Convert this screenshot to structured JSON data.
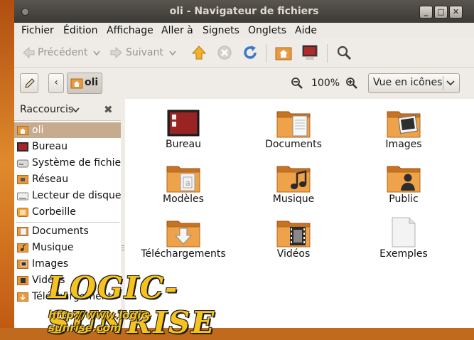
{
  "window": {
    "title": "oli - Navigateur de fichiers",
    "btn_min": "_",
    "btn_max": "□",
    "btn_close": "✕"
  },
  "menubar": {
    "items": [
      {
        "label": "Fichier"
      },
      {
        "label": "Édition"
      },
      {
        "label": "Affichage"
      },
      {
        "label": "Aller à"
      },
      {
        "label": "Signets"
      },
      {
        "label": "Onglets"
      },
      {
        "label": "Aide"
      }
    ]
  },
  "toolbar": {
    "back_label": "Précédent",
    "forward_label": "Suivant"
  },
  "location": {
    "path_back": "‹",
    "path_current": "oli",
    "zoom": "100%",
    "view_mode": "Vue en icônes"
  },
  "sidebar": {
    "header": "Raccourcis",
    "close": "✖",
    "items": [
      {
        "label": "oli",
        "icon": "home-folder-icon"
      },
      {
        "label": "Bureau",
        "icon": "desktop-icon"
      },
      {
        "label": "Système de fichiers",
        "icon": "drive-icon"
      },
      {
        "label": "Réseau",
        "icon": "network-icon"
      },
      {
        "label": "Lecteur de disquette",
        "icon": "floppy-icon"
      },
      {
        "label": "Corbeille",
        "icon": "trash-icon"
      },
      {
        "label": "Documents",
        "icon": "bookmark-folder-icon"
      },
      {
        "label": "Musique",
        "icon": "bookmark-folder-icon"
      },
      {
        "label": "Images",
        "icon": "bookmark-folder-icon"
      },
      {
        "label": "Vidéos",
        "icon": "bookmark-folder-icon"
      },
      {
        "label": "Téléchargements",
        "icon": "bookmark-folder-icon"
      }
    ]
  },
  "files": [
    {
      "label": "Bureau",
      "icon": "desktop-folder-icon"
    },
    {
      "label": "Documents",
      "icon": "documents-folder-icon"
    },
    {
      "label": "Images",
      "icon": "pictures-folder-icon"
    },
    {
      "label": "Modèles",
      "icon": "templates-folder-icon"
    },
    {
      "label": "Musique",
      "icon": "music-folder-icon"
    },
    {
      "label": "Public",
      "icon": "public-folder-icon"
    },
    {
      "label": "Téléchargements",
      "icon": "downloads-folder-icon"
    },
    {
      "label": "Vidéos",
      "icon": "videos-folder-icon"
    },
    {
      "label": "Exemples",
      "icon": "file-icon"
    }
  ],
  "watermark": {
    "title": "LOGIC-SUNRISE",
    "url": "http://www.logic-sunrise.com"
  },
  "colors": {
    "folder": "#e89a3c",
    "folder_dark": "#c06c1c",
    "selection": "#c7ab8f",
    "titlebar": "#3c3a36"
  }
}
